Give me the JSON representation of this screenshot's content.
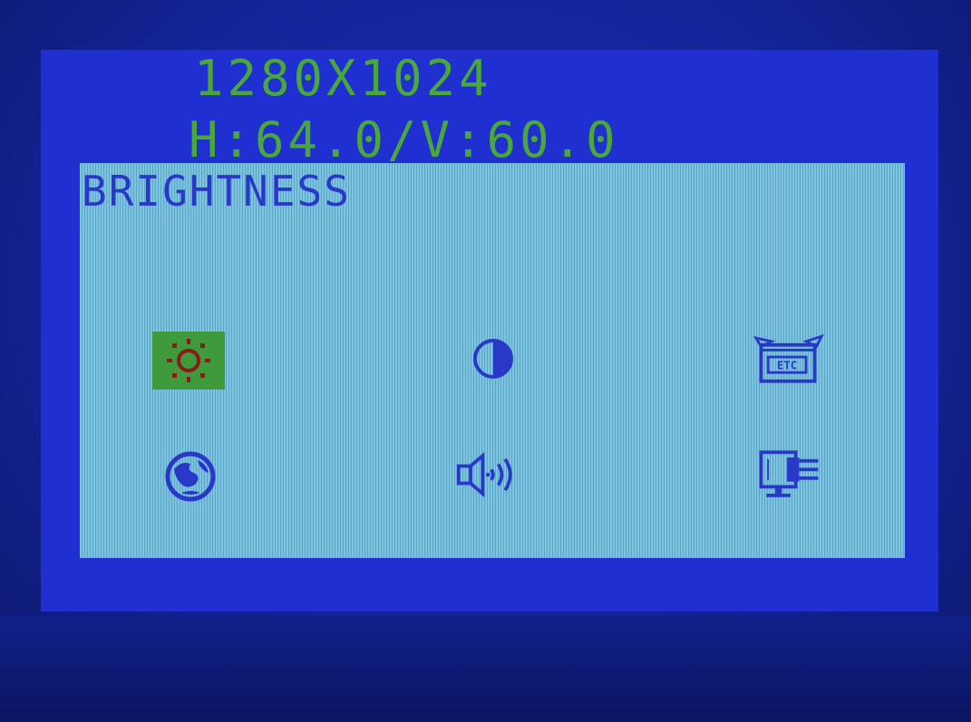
{
  "signal": {
    "resolution": "1280X1024",
    "frequency": "H:64.0/V:60.0"
  },
  "menu": {
    "title": "BRIGHTNESS",
    "items": [
      {
        "name": "brightness",
        "icon": "sun-icon",
        "selected": true
      },
      {
        "name": "contrast",
        "icon": "contrast-icon",
        "selected": false
      },
      {
        "name": "etc",
        "icon": "etc-box-icon",
        "label": "ETC",
        "selected": false
      },
      {
        "name": "color",
        "icon": "globe-icon",
        "selected": false
      },
      {
        "name": "audio",
        "icon": "speaker-icon",
        "selected": false
      },
      {
        "name": "display",
        "icon": "monitor-settings-icon",
        "selected": false
      }
    ]
  },
  "colors": {
    "background": "#1f2fd0",
    "panel": "#7ec4df",
    "text_green": "#4aa83a",
    "text_blue": "#2a38c8",
    "selection": "#3f9a3c",
    "icon_selected": "#8b1a1a"
  }
}
